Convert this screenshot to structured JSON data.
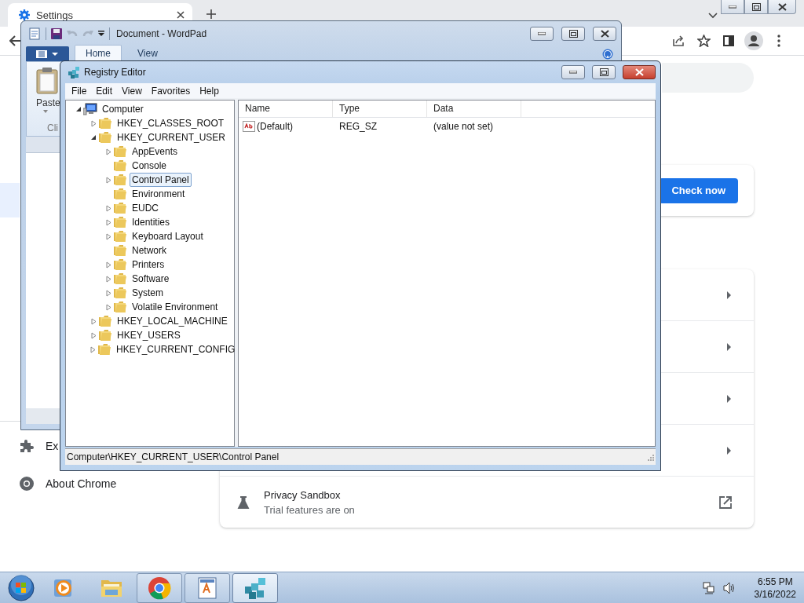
{
  "browser": {
    "tab": {
      "title": "Settings",
      "selected": true
    },
    "settings": {
      "sidebar": [
        {
          "kind": "covered",
          "selected": true
        },
        {
          "kind": "extensions",
          "label": "Ex",
          "selected": false
        },
        {
          "kind": "about",
          "label": "About Chrome",
          "selected": false
        }
      ],
      "safety_check": {
        "button": "Check now"
      },
      "rows": [
        {
          "kind": "arrow"
        },
        {
          "kind": "arrow"
        },
        {
          "kind": "arrow"
        },
        {
          "kind": "arrow"
        },
        {
          "kind": "external",
          "title": "Privacy Sandbox",
          "subtitle": "Trial features are on"
        }
      ]
    }
  },
  "wordpad": {
    "title": "Document - WordPad",
    "tabs": [
      {
        "label": "Home",
        "selected": true
      },
      {
        "label": "View",
        "selected": false
      }
    ],
    "paste_label": "Paste",
    "group_label": "Cli"
  },
  "regedit": {
    "title": "Registry Editor",
    "menu": [
      "File",
      "Edit",
      "View",
      "Favorites",
      "Help"
    ],
    "tree": [
      {
        "kind": "computer",
        "label": "Computer",
        "expanded": true,
        "selected": false,
        "children": [
          {
            "kind": "folder",
            "label": "HKEY_CLASSES_ROOT",
            "expanded": false,
            "selected": false
          },
          {
            "kind": "folder",
            "label": "HKEY_CURRENT_USER",
            "expanded": true,
            "selected": false,
            "children": [
              {
                "kind": "folder",
                "label": "AppEvents",
                "expanded": false,
                "selected": false
              },
              {
                "kind": "folder",
                "label": "Console",
                "selected": false
              },
              {
                "kind": "folder",
                "label": "Control Panel",
                "expanded": false,
                "selected": true
              },
              {
                "kind": "folder",
                "label": "Environment",
                "selected": false
              },
              {
                "kind": "folder",
                "label": "EUDC",
                "expanded": false,
                "selected": false
              },
              {
                "kind": "folder",
                "label": "Identities",
                "expanded": false,
                "selected": false
              },
              {
                "kind": "folder",
                "label": "Keyboard Layout",
                "expanded": false,
                "selected": false
              },
              {
                "kind": "folder",
                "label": "Network",
                "selected": false
              },
              {
                "kind": "folder",
                "label": "Printers",
                "expanded": false,
                "selected": false
              },
              {
                "kind": "folder",
                "label": "Software",
                "expanded": false,
                "selected": false
              },
              {
                "kind": "folder",
                "label": "System",
                "expanded": false,
                "selected": false
              },
              {
                "kind": "folder",
                "label": "Volatile Environment",
                "expanded": false,
                "selected": false
              }
            ]
          },
          {
            "kind": "folder",
            "label": "HKEY_LOCAL_MACHINE",
            "expanded": false,
            "selected": false
          },
          {
            "kind": "folder",
            "label": "HKEY_USERS",
            "expanded": false,
            "selected": false
          },
          {
            "kind": "folder",
            "label": "HKEY_CURRENT_CONFIG",
            "expanded": false,
            "selected": false
          }
        ]
      }
    ],
    "columns": [
      "Name",
      "Type",
      "Data"
    ],
    "rows": [
      {
        "name": "(Default)",
        "type": "REG_SZ",
        "data": "(value not set)"
      }
    ],
    "status_bar": "Computer\\HKEY_CURRENT_USER\\Control Panel"
  },
  "taskbar": {
    "apps": [
      {
        "kind": "media",
        "running": false,
        "selected": false
      },
      {
        "kind": "explorer",
        "running": false,
        "selected": false
      },
      {
        "kind": "browser",
        "running": true,
        "selected": false
      },
      {
        "kind": "wordpad",
        "running": true,
        "selected": false
      },
      {
        "kind": "regedit",
        "running": true,
        "selected": true
      }
    ],
    "time": "6:55 PM",
    "date": "3/16/2022"
  }
}
